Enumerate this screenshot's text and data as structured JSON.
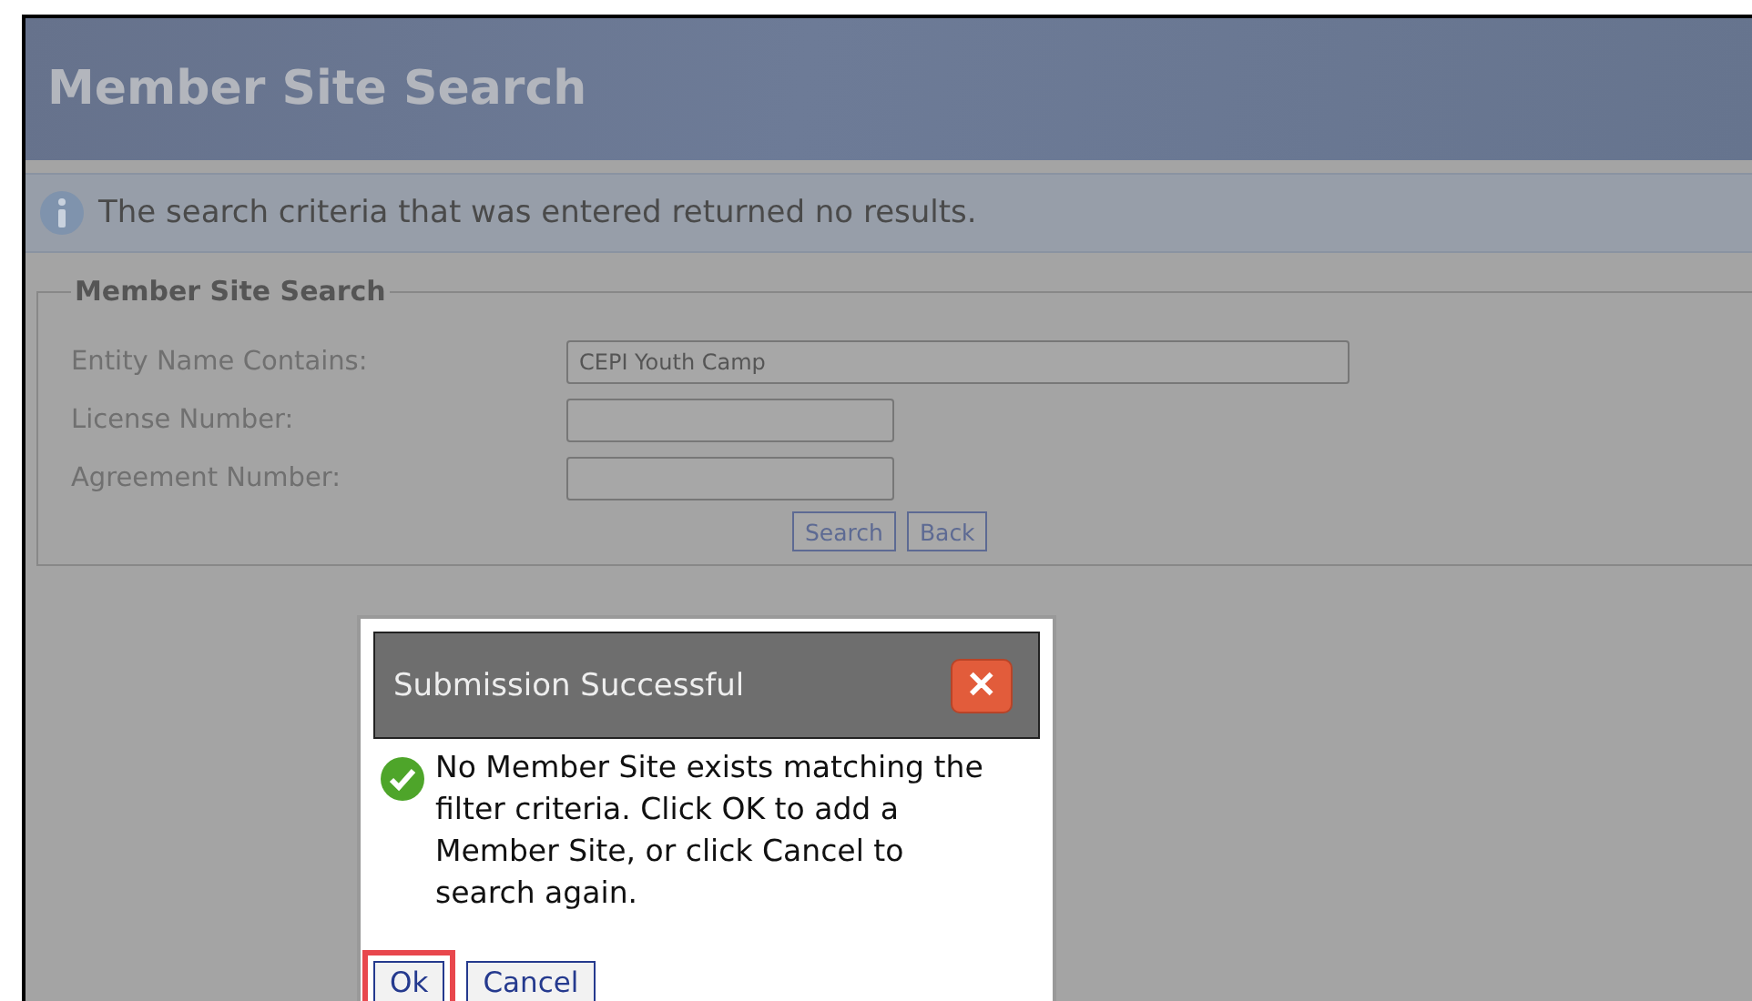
{
  "header": {
    "title": "Member Site Search"
  },
  "info_message": "The search criteria that was entered returned no results.",
  "search_form": {
    "legend": "Member Site Search",
    "fields": [
      {
        "label": "Entity Name Contains:",
        "value": "CEPI Youth Camp",
        "kind": "wide"
      },
      {
        "label": "License Number:",
        "kind": "short"
      },
      {
        "label": "Agreement Number:",
        "kind": "short"
      }
    ],
    "buttons": [
      "Search",
      "Back"
    ]
  },
  "dialog": {
    "title": "Submission Successful",
    "close": "✕",
    "message": "No Member Site exists matching the filter criteria. Click OK to add a Member Site, or click Cancel to search again.",
    "buttons": [
      {
        "label": "Ok",
        "highlighted": true
      },
      {
        "label": "Cancel",
        "highlighted": false
      }
    ]
  }
}
